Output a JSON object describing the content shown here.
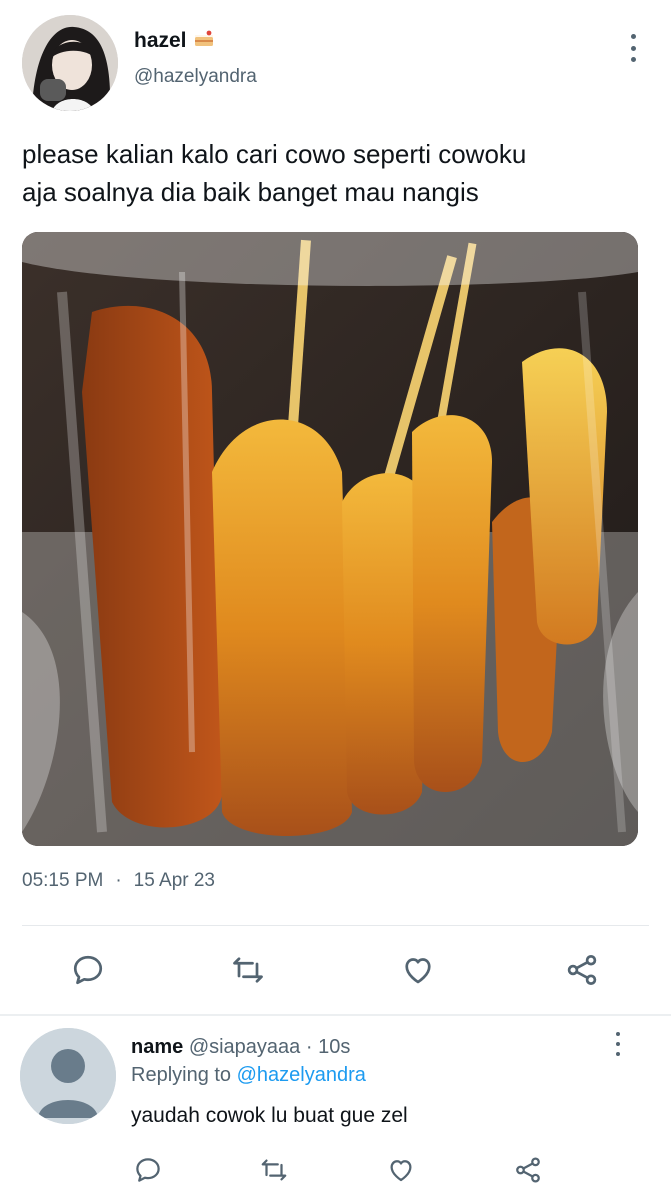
{
  "tweet": {
    "display_name": "hazel",
    "name_emoji": "cake-icon",
    "handle": "@hazelyandra",
    "text_line1": "please kalian kalo cari cowo seperti cowoku",
    "text_line2": "aja soalnya dia baik banget mau nangis",
    "photo_subject": "corn-dog-skewers-in-plastic-bag",
    "time": "05:15 PM",
    "dot": "·",
    "date": "15 Apr 23",
    "actions": [
      "reply-icon",
      "retweet-icon",
      "like-icon",
      "share-icon"
    ]
  },
  "reply": {
    "display_name": "name",
    "handle": "@siapayaaa",
    "dot": "·",
    "age": "10s",
    "replying_prefix": "Replying to",
    "replying_to": "@hazelyandra",
    "text": "yaudah cowok lu buat gue zel",
    "actions": [
      "reply-icon",
      "retweet-icon",
      "like-icon",
      "share-icon"
    ]
  },
  "colors": {
    "text_primary": "#0f1419",
    "text_secondary": "#536471",
    "link": "#1d9bf0",
    "divider": "#e6e9ec"
  }
}
